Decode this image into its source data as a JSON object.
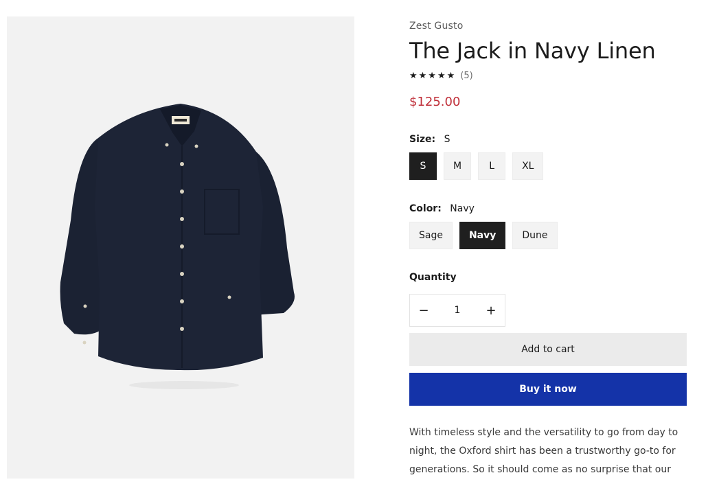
{
  "product": {
    "vendor": "Zest Gusto",
    "title": "The Jack in Navy Linen",
    "stars": "★★★★★",
    "review_count": "(5)",
    "rating_value": 5,
    "price": "$125.00",
    "image_alt": "navy linen button-down shirt"
  },
  "size": {
    "label": "Size:",
    "selected": "S",
    "options": [
      "S",
      "M",
      "L",
      "XL"
    ]
  },
  "color": {
    "label": "Color:",
    "selected": "Navy",
    "options": [
      "Sage",
      "Navy",
      "Dune"
    ]
  },
  "quantity": {
    "label": "Quantity",
    "value": "1",
    "minus": "−",
    "plus": "+"
  },
  "actions": {
    "add_to_cart": "Add to cart",
    "buy_now": "Buy it now"
  },
  "description": "With timeless style and the versatility to go from day to night, the Oxford shirt has been a trustworthy go-to for generations. So it should come as no surprise that our",
  "colors": {
    "price": "#c0303a",
    "buy_button": "#1433a8",
    "selected_swatch": "#1f1f1f"
  }
}
